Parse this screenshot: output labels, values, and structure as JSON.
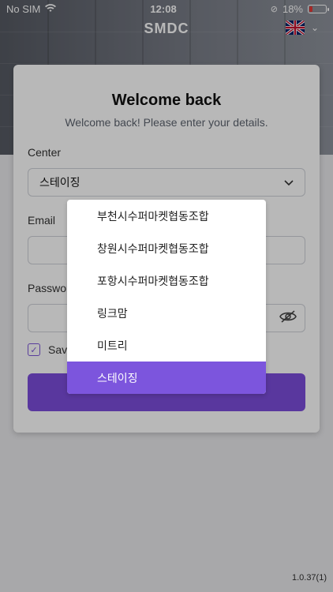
{
  "status_bar": {
    "carrier": "No SIM",
    "time": "12:08",
    "battery": "18%"
  },
  "header": {
    "title": "SMDC",
    "language_icon": "uk-flag-icon"
  },
  "login": {
    "heading": "Welcome back",
    "subtitle": "Welcome back! Please enter your details.",
    "center_label": "Center",
    "center_value": "스테이징",
    "email_label": "Email",
    "password_label": "Password",
    "remember_label": "Save",
    "signin_label": ""
  },
  "dropdown": {
    "options": [
      "부천시수퍼마켓협동조합",
      "창원시수퍼마켓협동조합",
      "포항시수퍼마켓협동조합",
      "링크맘",
      "미트리",
      "스테이징"
    ],
    "selected": "스테이징"
  },
  "footer": {
    "version": "1.0.37(1)"
  },
  "colors": {
    "accent": "#7c55dd"
  }
}
